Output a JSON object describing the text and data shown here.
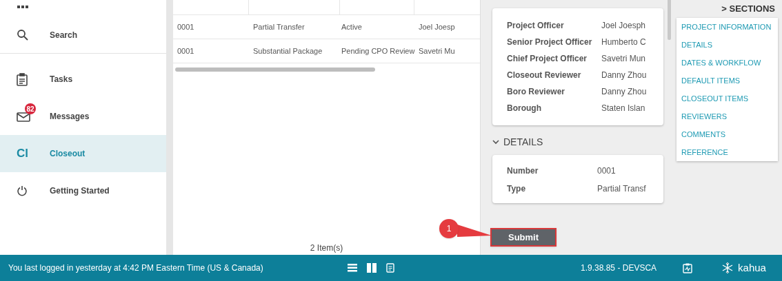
{
  "sidebar": {
    "items": [
      {
        "label": "Search",
        "selected": false
      },
      {
        "label": "Tasks",
        "selected": false
      },
      {
        "label": "Messages",
        "badge": "82",
        "selected": false
      },
      {
        "label": "Closeout",
        "icon_text": "Cl",
        "selected": true
      },
      {
        "label": "Getting Started",
        "selected": false
      }
    ]
  },
  "table": {
    "rows": [
      [
        "0001",
        "Partial Transfer",
        "Active",
        "Joel Joesp"
      ],
      [
        "0001",
        "Substantial Package",
        "Pending CPO Review",
        "Savetri Mu"
      ]
    ],
    "count": "2 Item(s)"
  },
  "sections_title": "> SECTIONS",
  "project_information": [
    [
      "Project Officer",
      "Joel Joesph"
    ],
    [
      "Senior Project Officer",
      "Humberto C"
    ],
    [
      "Chief Project Officer",
      "Savetri Mun"
    ],
    [
      "Closeout Reviewer",
      "Danny Zhou"
    ],
    [
      "Boro Reviewer",
      "Danny Zhou"
    ],
    [
      "Borough",
      "Staten Islan"
    ]
  ],
  "details": {
    "title": "DETAILS",
    "expanded": true,
    "fields": [
      [
        "Number",
        "0001"
      ],
      [
        "Type",
        "Partial Transf"
      ]
    ]
  },
  "sections": [
    "PROJECT INFORMATION",
    "DETAILS",
    "DATES & WORKFLOW",
    "DEFAULT ITEMS",
    "CLOSEOUT ITEMS",
    "REVIEWERS",
    "COMMENTS",
    "REFERENCE"
  ],
  "submit": "Submit",
  "callout": "1",
  "status_bar": {
    "message": "You last logged in yesterday at 4:42 PM Eastern Time (US & Canada)",
    "version": "1.9.38.85 - DEVSCA",
    "brand": "kahua"
  }
}
